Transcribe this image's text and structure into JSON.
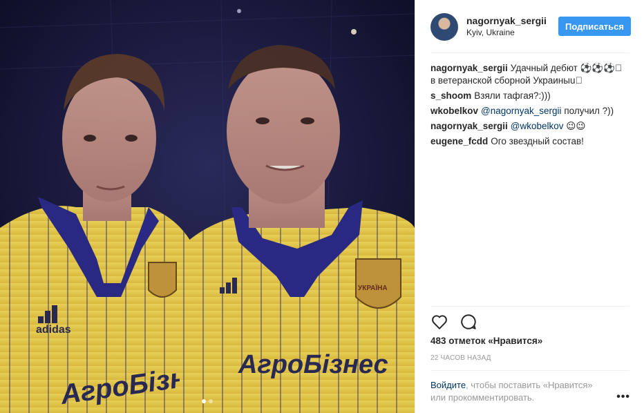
{
  "header": {
    "username": "nagornyak_sergii",
    "location": "Kyiv, Ukraine",
    "follow_label": "Подписаться"
  },
  "comments": [
    {
      "user": "nagornyak_sergii",
      "pre": "Удачный дебют ⚽⚽⚽\u0000 в ветеранской сборной Украиныu\u0000",
      "mention": "",
      "post": ""
    },
    {
      "user": "s_shoom",
      "pre": "Взяли тафгая?:)))",
      "mention": "",
      "post": ""
    },
    {
      "user": "wkobelkov",
      "pre": "",
      "mention": "@nagornyak_sergii",
      "post": " получил ?))"
    },
    {
      "user": "nagornyak_sergii",
      "pre": "",
      "mention": "@wkobelkov",
      "post": " 😉😉"
    },
    {
      "user": "eugene_fcdd",
      "pre": "Ого звездный состав!",
      "mention": "",
      "post": ""
    }
  ],
  "likes": "483 отметок «Нравится»",
  "time": "22 часов назад",
  "login_prompt": {
    "link": "Войдите",
    "text": ", чтобы поставить «Нравится» или прокомментировать."
  },
  "more": "•••",
  "photo": {
    "shirt_text_left": "АгроБізнес",
    "shirt_text_right": "АгроБізнес",
    "crest_text": "УКРАЇНА",
    "brand_text": "adidas"
  },
  "colors": {
    "accent": "#3897f0",
    "link": "#003569",
    "muted": "#999999",
    "jersey_yellow": "#f2d24a",
    "collar_blue": "#2a2a88"
  },
  "carousel": {
    "count": 2,
    "active": 1
  }
}
